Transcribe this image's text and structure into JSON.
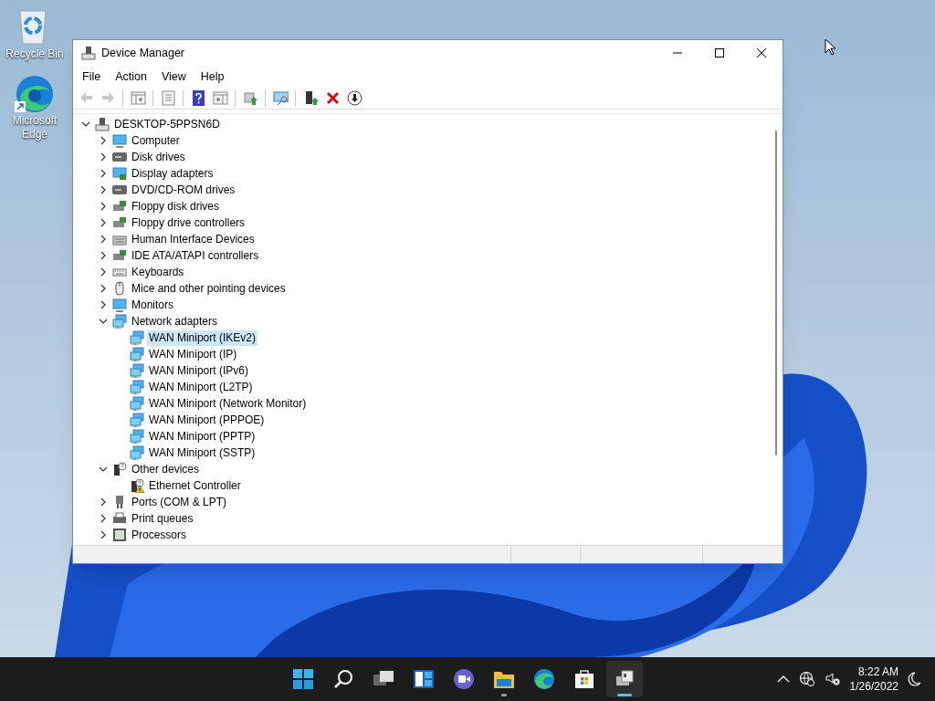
{
  "desktop_icons": [
    {
      "kind": "recycle",
      "label": "Recycle Bin"
    },
    {
      "kind": "edge",
      "label": "Microsoft Edge"
    }
  ],
  "window": {
    "title": "Device Manager"
  },
  "menu": [
    "File",
    "Action",
    "View",
    "Help"
  ],
  "toolbar": [
    {
      "kind": "back",
      "disabled": true
    },
    {
      "kind": "forward",
      "disabled": true
    },
    {
      "kind": "sep"
    },
    {
      "kind": "show-hide",
      "disabled": false
    },
    {
      "kind": "sep"
    },
    {
      "kind": "properties",
      "disabled": false
    },
    {
      "kind": "sep"
    },
    {
      "kind": "help",
      "disabled": false
    },
    {
      "kind": "action-pane",
      "disabled": false
    },
    {
      "kind": "sep"
    },
    {
      "kind": "update",
      "disabled": false
    },
    {
      "kind": "sep"
    },
    {
      "kind": "scan",
      "disabled": false
    },
    {
      "kind": "sep"
    },
    {
      "kind": "enable",
      "disabled": false
    },
    {
      "kind": "uninstall",
      "disabled": false
    },
    {
      "kind": "download",
      "disabled": false
    }
  ],
  "tree": [
    {
      "label": "DESKTOP-5PPSN6D",
      "kind": "computer",
      "expanded": true,
      "selected": false,
      "children": [
        {
          "label": "Computer",
          "kind": "monitor",
          "expanded": false,
          "selected": false
        },
        {
          "label": "Disk drives",
          "kind": "disk",
          "expanded": false,
          "selected": false
        },
        {
          "label": "Display adapters",
          "kind": "display",
          "expanded": false,
          "selected": false
        },
        {
          "label": "DVD/CD-ROM drives",
          "kind": "disk",
          "expanded": false,
          "selected": false
        },
        {
          "label": "Floppy disk drives",
          "kind": "floppy",
          "expanded": false,
          "selected": false
        },
        {
          "label": "Floppy drive controllers",
          "kind": "floppy",
          "expanded": false,
          "selected": false
        },
        {
          "label": "Human Interface Devices",
          "kind": "hid",
          "expanded": false,
          "selected": false
        },
        {
          "label": "IDE ATA/ATAPI controllers",
          "kind": "floppy",
          "expanded": false,
          "selected": false
        },
        {
          "label": "Keyboards",
          "kind": "keyboard",
          "expanded": false,
          "selected": false
        },
        {
          "label": "Mice and other pointing devices",
          "kind": "mouse",
          "expanded": false,
          "selected": false
        },
        {
          "label": "Monitors",
          "kind": "monitor",
          "expanded": false,
          "selected": false
        },
        {
          "label": "Network adapters",
          "kind": "network",
          "expanded": true,
          "selected": false,
          "children": [
            {
              "label": "WAN Miniport (IKEv2)",
              "kind": "network",
              "selected": true
            },
            {
              "label": "WAN Miniport (IP)",
              "kind": "network",
              "selected": false
            },
            {
              "label": "WAN Miniport (IPv6)",
              "kind": "network",
              "selected": false
            },
            {
              "label": "WAN Miniport (L2TP)",
              "kind": "network",
              "selected": false
            },
            {
              "label": "WAN Miniport (Network Monitor)",
              "kind": "network",
              "selected": false
            },
            {
              "label": "WAN Miniport (PPPOE)",
              "kind": "network",
              "selected": false
            },
            {
              "label": "WAN Miniport (PPTP)",
              "kind": "network",
              "selected": false
            },
            {
              "label": "WAN Miniport (SSTP)",
              "kind": "network",
              "selected": false
            }
          ]
        },
        {
          "label": "Other devices",
          "kind": "unknown",
          "expanded": true,
          "selected": false,
          "children": [
            {
              "label": "Ethernet Controller",
              "kind": "unknown",
              "warning": true,
              "selected": false
            }
          ]
        },
        {
          "label": "Ports (COM & LPT)",
          "kind": "port",
          "expanded": false,
          "selected": false
        },
        {
          "label": "Print queues",
          "kind": "printer",
          "expanded": false,
          "selected": false
        },
        {
          "label": "Processors",
          "kind": "processor",
          "expanded": false,
          "selected": false
        }
      ]
    }
  ],
  "taskbar": [
    {
      "kind": "start",
      "running": false,
      "selected": false
    },
    {
      "kind": "search",
      "running": false,
      "selected": false
    },
    {
      "kind": "task-view",
      "running": false,
      "selected": false
    },
    {
      "kind": "widgets",
      "running": false,
      "selected": false
    },
    {
      "kind": "chat",
      "running": false,
      "selected": false
    },
    {
      "kind": "explorer",
      "running": true,
      "selected": false
    },
    {
      "kind": "edge",
      "running": false,
      "selected": false
    },
    {
      "kind": "store",
      "running": false,
      "selected": false
    },
    {
      "kind": "device-manager",
      "running": true,
      "selected": true
    }
  ],
  "tray": {
    "time": "8:22 AM",
    "date": "1/26/2022"
  }
}
